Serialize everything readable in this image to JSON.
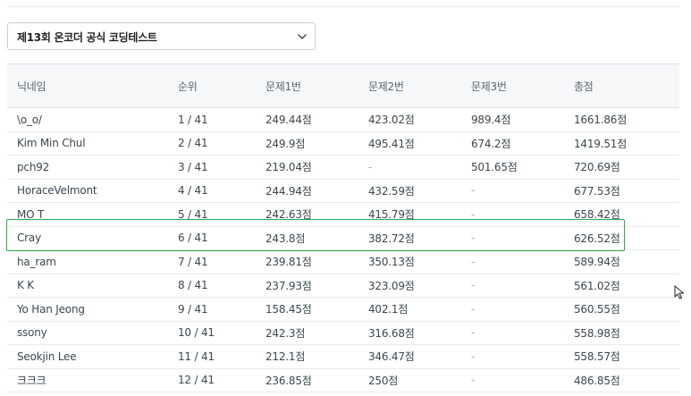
{
  "contest_select": {
    "selected": "제13회 온코더 공식 코딩테스트"
  },
  "leaderboard": {
    "columns": [
      "닉네임",
      "순위",
      "문제1번",
      "문제2번",
      "문제3번",
      "총점"
    ],
    "rows": [
      {
        "name": "\\o_o/",
        "rank": "1 / 41",
        "p1": "249.44점",
        "p2": "423.02점",
        "p3": "989.4점",
        "total": "1661.86점"
      },
      {
        "name": "Kim Min Chul",
        "rank": "2 / 41",
        "p1": "249.9점",
        "p2": "495.41점",
        "p3": "674.2점",
        "total": "1419.51점"
      },
      {
        "name": "pch92",
        "rank": "3 / 41",
        "p1": "219.04점",
        "p2": "-",
        "p3": "501.65점",
        "total": "720.69점"
      },
      {
        "name": "HoraceVelmont",
        "rank": "4 / 41",
        "p1": "244.94점",
        "p2": "432.59점",
        "p3": "-",
        "total": "677.53점"
      },
      {
        "name": "MO T",
        "rank": "5 / 41",
        "p1": "242.63점",
        "p2": "415.79점",
        "p3": "-",
        "total": "658.42점"
      },
      {
        "name": "Cray",
        "rank": "6 / 41",
        "p1": "243.8점",
        "p2": "382.72점",
        "p3": "-",
        "total": "626.52점"
      },
      {
        "name": "ha_ram",
        "rank": "7 / 41",
        "p1": "239.81점",
        "p2": "350.13점",
        "p3": "-",
        "total": "589.94점"
      },
      {
        "name": "K K",
        "rank": "8 / 41",
        "p1": "237.93점",
        "p2": "323.09점",
        "p3": "-",
        "total": "561.02점"
      },
      {
        "name": "Yo Han Jeong",
        "rank": "9 / 41",
        "p1": "158.45점",
        "p2": "402.1점",
        "p3": "-",
        "total": "560.55점"
      },
      {
        "name": "ssony",
        "rank": "10 / 41",
        "p1": "242.3점",
        "p2": "316.68점",
        "p3": "-",
        "total": "558.98점"
      },
      {
        "name": "Seokjin Lee",
        "rank": "11 / 41",
        "p1": "212.1점",
        "p2": "346.47점",
        "p3": "-",
        "total": "558.57점"
      },
      {
        "name": "크크크",
        "rank": "12 / 41",
        "p1": "236.85점",
        "p2": "250점",
        "p3": "-",
        "total": "486.85점"
      }
    ]
  },
  "icons": {
    "dropdown": "chevron-down-icon",
    "pointer": "mouse-cursor-icon"
  },
  "colors": {
    "highlight": "#2eaa4a",
    "header_bg": "#f5f7f9"
  }
}
